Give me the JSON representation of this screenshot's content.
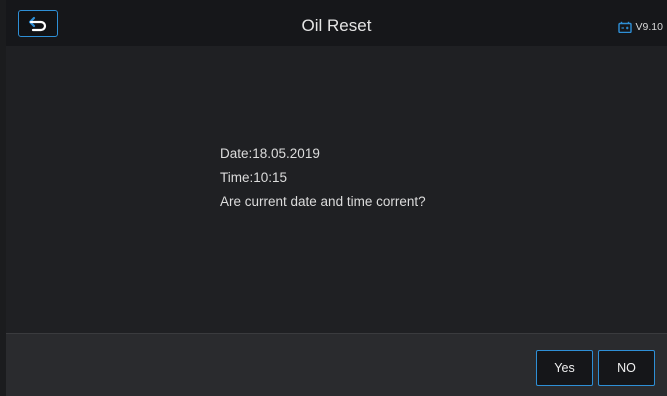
{
  "header": {
    "title": "Oil Reset",
    "version": "V9.10",
    "back_icon": "back-arrow-icon",
    "battery_icon": "battery-icon"
  },
  "message": {
    "date_line": "Date:18.05.2019",
    "time_line": "Time:10:15",
    "question": "Are current date and time corrent?"
  },
  "footer": {
    "yes_label": "Yes",
    "no_label": "NO"
  },
  "colors": {
    "accent": "#2e8fd6",
    "background": "#1f2023"
  }
}
